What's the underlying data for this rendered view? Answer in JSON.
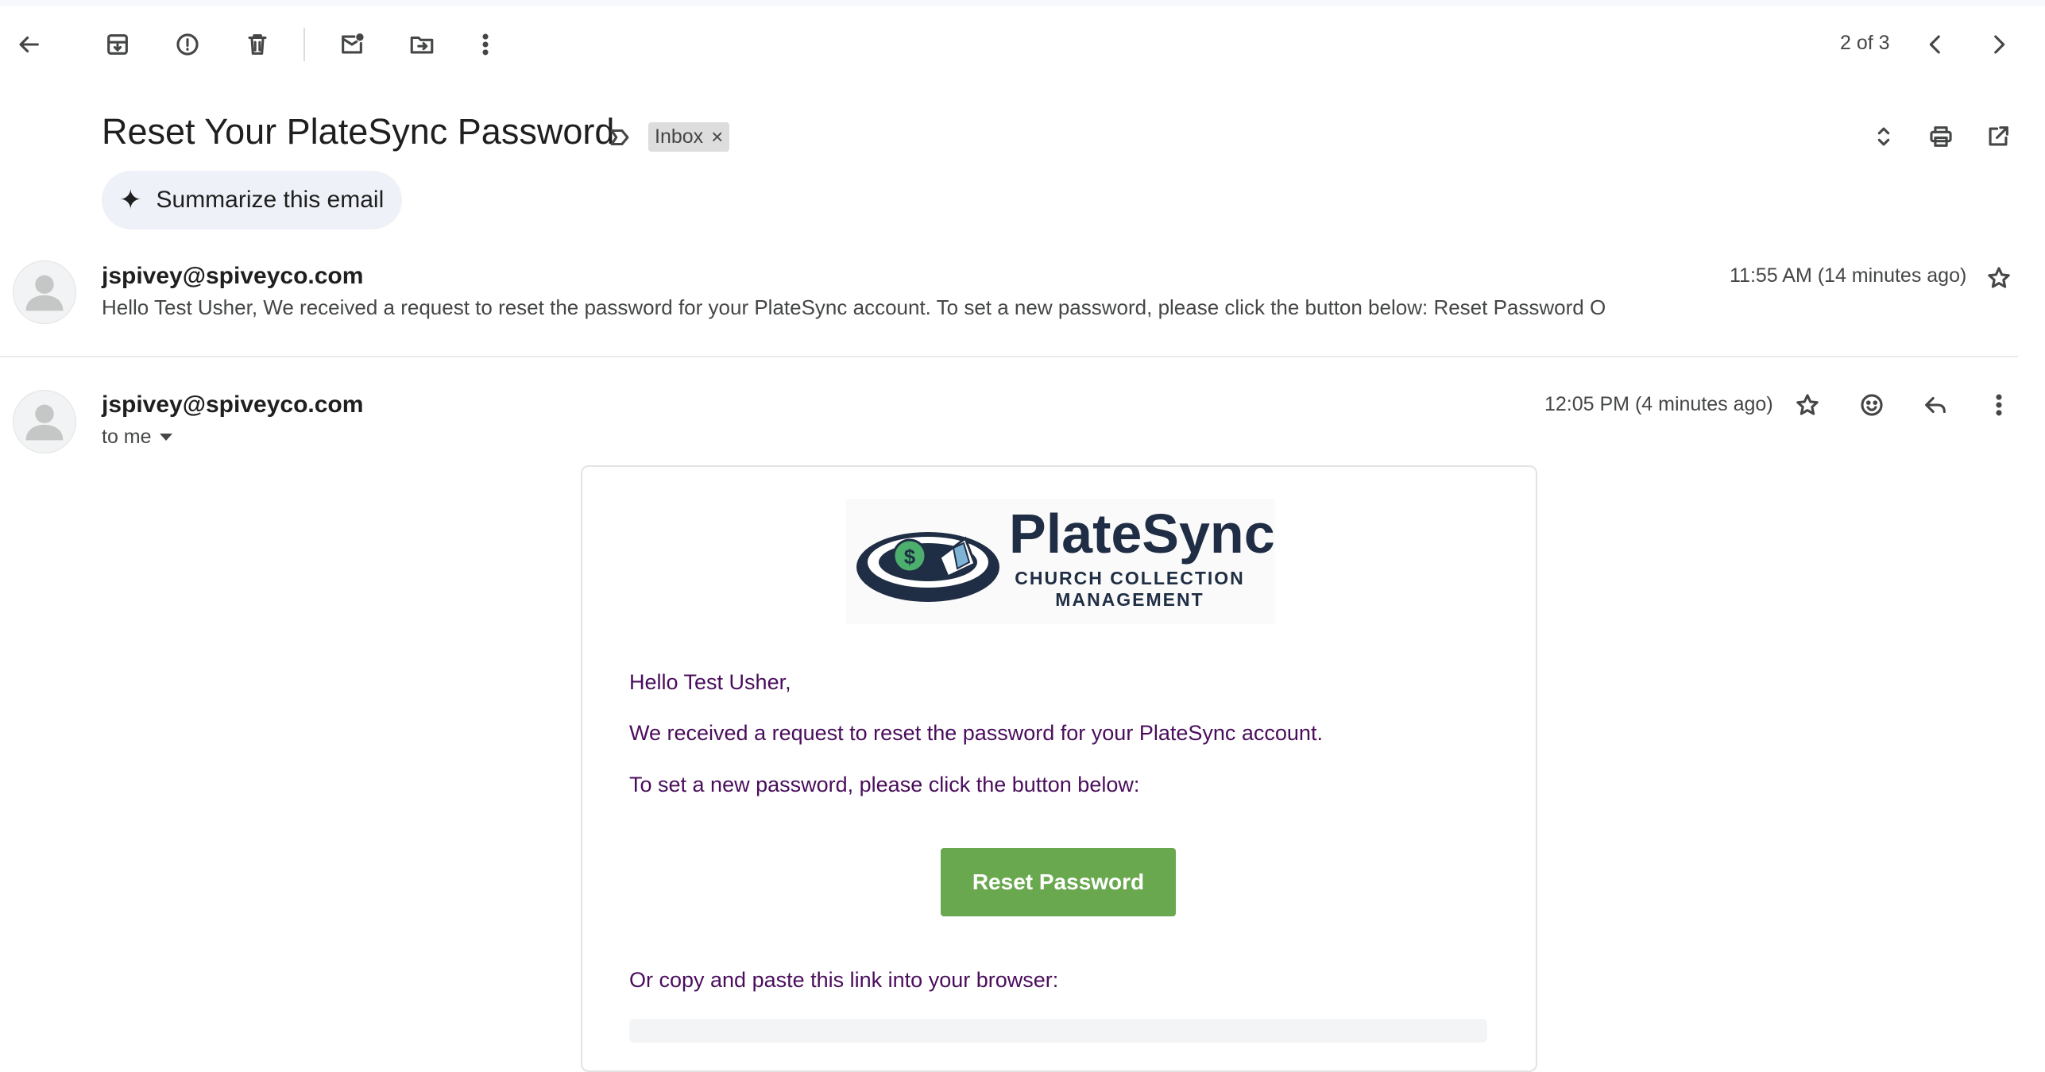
{
  "toolbar": {
    "icons": [
      "back-arrow-icon",
      "archive-icon",
      "report-spam-icon",
      "delete-icon",
      "mark-unread-icon",
      "move-to-icon",
      "more-vert-icon"
    ],
    "pagination": "2 of 3"
  },
  "subject": {
    "title": "Reset Your PlateSync Password",
    "label_chip": "Inbox",
    "label_remove": "×"
  },
  "summarize": {
    "label": "Summarize this email"
  },
  "messages": [
    {
      "sender": "jspivey@spiveyco.com",
      "snippet": "Hello Test Usher, We received a request to reset the password for your PlateSync account. To set a new password, please click the button below: Reset Password O",
      "time": "11:55 AM (14 minutes ago)"
    },
    {
      "sender": "jspivey@spiveyco.com",
      "recipient": "to me",
      "time": "12:05 PM (4 minutes ago)"
    }
  ],
  "email_body": {
    "logo": {
      "brand": "PlateSync",
      "tagline_1": "CHURCH COLLECTION",
      "tagline_2": "MANAGEMENT"
    },
    "greeting": "Hello Test Usher,",
    "para1": "We received a request to reset the password for your PlateSync account.",
    "para2": "To set a new password, please click the button below:",
    "button": "Reset Password",
    "para3": "Or copy and paste this link into your browser:"
  },
  "colors": {
    "button_green": "#6aa84f",
    "body_text_purple": "#4a0d5c",
    "logo_navy": "#1f2e44",
    "logo_green": "#4caf6e"
  }
}
